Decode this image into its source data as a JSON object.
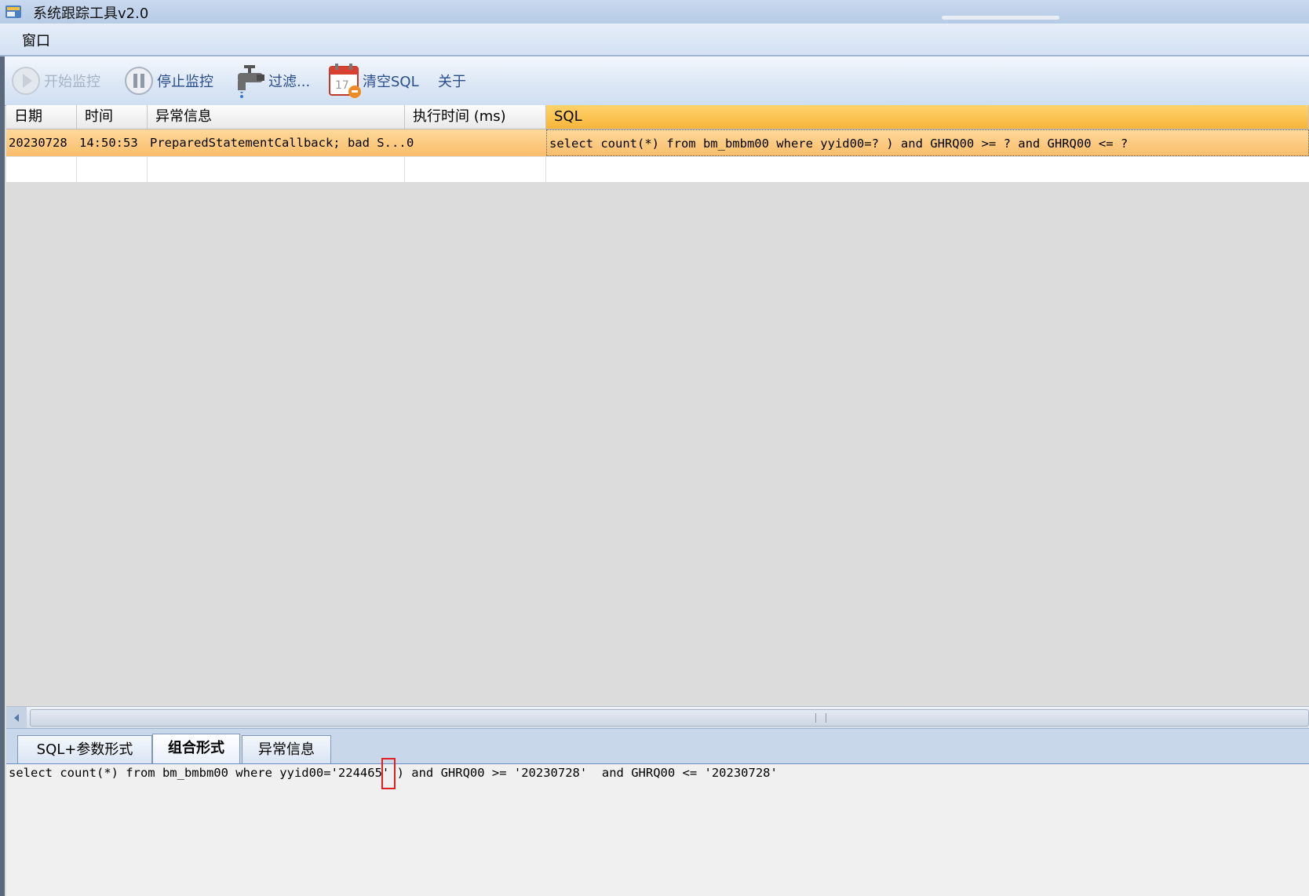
{
  "window": {
    "title": "系统跟踪工具v2.0"
  },
  "menu": {
    "items": [
      "窗口"
    ]
  },
  "toolbar": {
    "start_label": "开始监控",
    "stop_label": "停止监控",
    "filter_label": "过滤...",
    "clear_label": "清空SQL",
    "about_label": "关于"
  },
  "grid": {
    "columns": [
      "日期",
      "时间",
      "异常信息",
      "执行时间 (ms)",
      "SQL"
    ],
    "rows": [
      {
        "date": "20230728",
        "time": "14:50:53",
        "exception": "PreparedStatementCallback; bad S...",
        "exec_time": "0",
        "sql": "select count(*) from bm_bmbm00 where yyid00=? ) and GHRQ00 >= ?  and GHRQ00 <= ?"
      }
    ]
  },
  "tabs": [
    "SQL+参数形式",
    "组合形式",
    "异常信息"
  ],
  "active_tab": "组合形式",
  "detail": {
    "sql": "select count(*) from bm_bmbm00 where yyid00='224465' ) and GHRQ00 >= '20230728'  and GHRQ00 <= '20230728'"
  },
  "colors": {
    "selected_row": "#f9bd6a",
    "active_header": "#f7b63a",
    "highlight_box": "#e02020"
  }
}
